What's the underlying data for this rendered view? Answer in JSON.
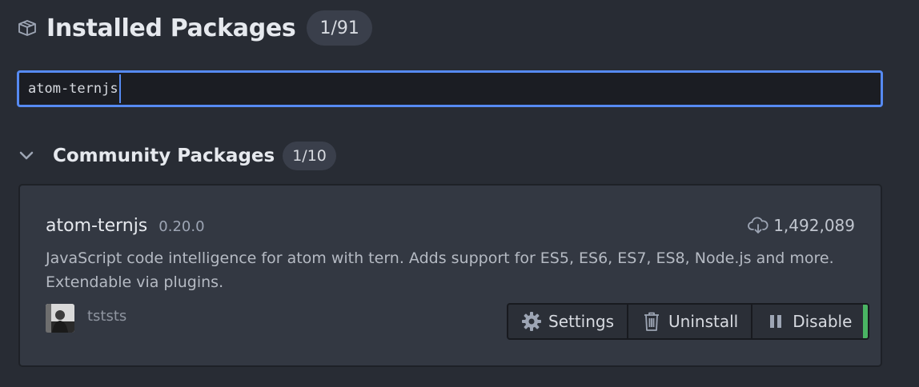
{
  "header": {
    "title": "Installed Packages",
    "count": "1/91"
  },
  "search": {
    "value": "atom-ternjs"
  },
  "section": {
    "title": "Community Packages",
    "count": "1/10"
  },
  "package": {
    "name": "atom-ternjs",
    "version": "0.20.0",
    "downloads": "1,492,089",
    "description": "JavaScript code intelligence for atom with tern. Adds support for ES5, ES6, ES7, ES8, Node.js and more. Extendable via plugins.",
    "author": "tststs",
    "buttons": {
      "settings": "Settings",
      "uninstall": "Uninstall",
      "disable": "Disable"
    }
  },
  "colors": {
    "background": "#282c34",
    "accent": "#568af2",
    "enabled_status": "#4ab463"
  },
  "icons": [
    "package-icon",
    "chevron-down-icon",
    "cloud-download-icon",
    "gear-icon",
    "trash-icon",
    "pause-icon"
  ]
}
